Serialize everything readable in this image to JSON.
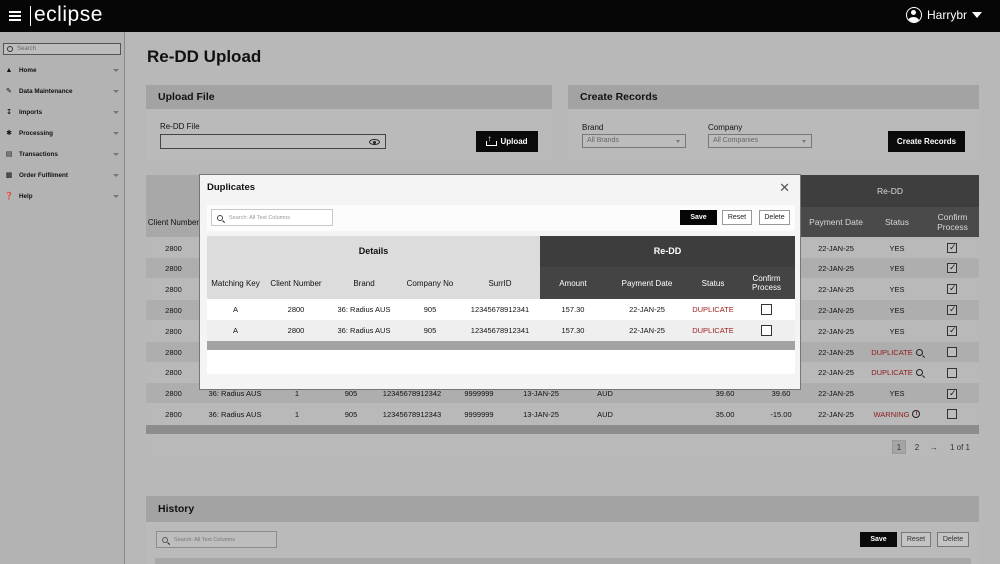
{
  "app": {
    "logo": "eclipse",
    "user": "Harrybr"
  },
  "sidebar": {
    "search_placeholder": "Search",
    "items": [
      {
        "label": "Home",
        "icon": "home-icon"
      },
      {
        "label": "Data Maintenance",
        "icon": "pencil-icon"
      },
      {
        "label": "Imports",
        "icon": "import-icon"
      },
      {
        "label": "Processing",
        "icon": "gear-icon"
      },
      {
        "label": "Transactions",
        "icon": "card-icon"
      },
      {
        "label": "Order Fulfilment",
        "icon": "clipboard-icon"
      },
      {
        "label": "Help",
        "icon": "help-icon"
      }
    ]
  },
  "page": {
    "title": "Re-DD Upload"
  },
  "upload_file": {
    "title": "Upload File",
    "field_label": "Re-DD File",
    "upload_label": "Upload"
  },
  "create_records": {
    "title": "Create Records",
    "brand_label": "Brand",
    "brand_value": "All Brands",
    "company_label": "Company",
    "company_value": "All Companies",
    "button_label": "Create Records"
  },
  "bg_table": {
    "group_header": "Re-DD",
    "headers": {
      "client_number": "Client Number",
      "payment_date": "Payment Date",
      "status": "Status",
      "confirm_process": "Confirm Process"
    },
    "rows": [
      {
        "client": "2800",
        "date": "22-JAN-25",
        "status": "YES",
        "checked": true
      },
      {
        "client": "2800",
        "date": "22-JAN-25",
        "status": "YES",
        "checked": true
      },
      {
        "client": "2800",
        "date": "22-JAN-25",
        "status": "YES",
        "checked": true
      },
      {
        "client": "2800",
        "date": "22-JAN-25",
        "status": "YES",
        "checked": true
      },
      {
        "client": "2800",
        "date": "22-JAN-25",
        "status": "YES",
        "checked": true
      },
      {
        "client": "2800",
        "date": "22-JAN-25",
        "status": "DUPLICATE",
        "checked": false
      },
      {
        "client": "2800",
        "date": "22-JAN-25",
        "status": "DUPLICATE",
        "checked": false
      },
      {
        "client": "2800",
        "brand": "36: Radius AUS",
        "key": "1",
        "company": "905",
        "surr": "12345678912342",
        "ref": "9999999",
        "created": "13-JAN-25",
        "currency": "AUD",
        "amount1": "39.60",
        "amount2": "39.60",
        "date": "22-JAN-25",
        "status": "YES",
        "checked": true
      },
      {
        "client": "2800",
        "brand": "36: Radius AUS",
        "key": "1",
        "company": "905",
        "surr": "12345678912343",
        "ref": "9999999",
        "created": "13-JAN-25",
        "currency": "AUD",
        "amount1": "35.00",
        "amount2": "-15.00",
        "date": "22-JAN-25",
        "status": "WARNING",
        "checked": false
      }
    ],
    "pagination": {
      "page1": "1",
      "page2": "2",
      "next": "→",
      "summary": "1 of 1"
    }
  },
  "history": {
    "title": "History",
    "search_placeholder": "Search: All Text Columns",
    "save": "Save",
    "reset": "Reset",
    "delete": "Delete"
  },
  "modal": {
    "title": "Duplicates",
    "close": "✕",
    "search_placeholder": "Search: All Text Columns",
    "save": "Save",
    "reset": "Reset",
    "delete": "Delete",
    "group_details": "Details",
    "group_redd": "Re-DD",
    "headers": {
      "matching_key": "Matching Key",
      "client_number": "Client Number",
      "brand": "Brand",
      "company_no": "Company No",
      "surrid": "SurrID",
      "amount": "Amount",
      "payment_date": "Payment Date",
      "status": "Status",
      "confirm_process": "Confirm Process"
    },
    "rows": [
      {
        "key": "A",
        "client": "2800",
        "brand": "36: Radius AUS",
        "company": "905",
        "surr": "12345678912341",
        "amount": "157.30",
        "date": "22-JAN-25",
        "status": "DUPLICATE"
      },
      {
        "key": "A",
        "client": "2800",
        "brand": "36: Radius AUS",
        "company": "905",
        "surr": "12345678912341",
        "amount": "157.30",
        "date": "22-JAN-25",
        "status": "DUPLICATE"
      }
    ]
  },
  "colors": {
    "topbar": "#060606",
    "dark_header": "#3e3e3e",
    "duplicate_red": "#9b1c1c"
  }
}
